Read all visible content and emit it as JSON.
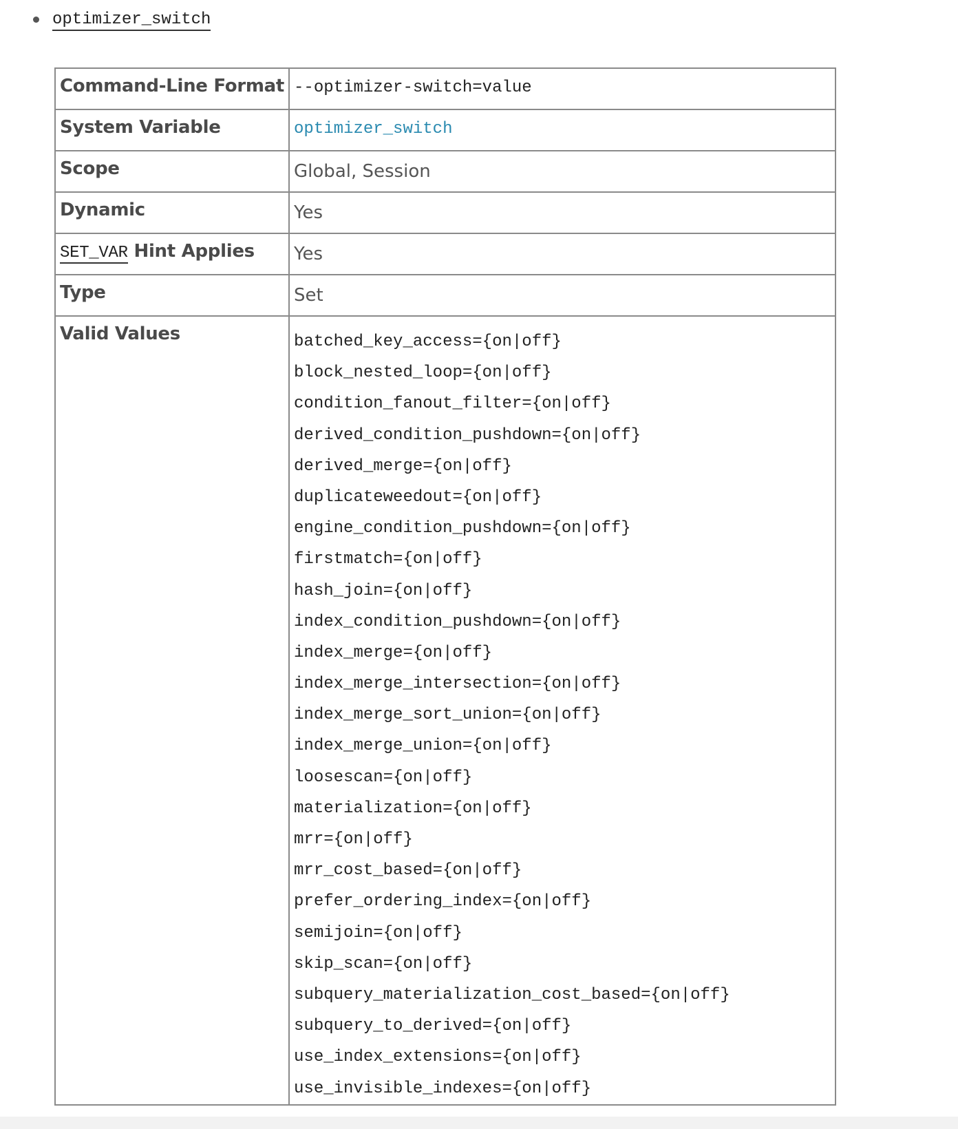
{
  "header": {
    "variable_name": "optimizer_switch"
  },
  "table": {
    "command_line_format_label": "Command-Line Format",
    "command_line_format_value": "--optimizer-switch=value",
    "system_variable_label": "System Variable",
    "system_variable_value": "optimizer_switch",
    "scope_label": "Scope",
    "scope_value": "Global, Session",
    "dynamic_label": "Dynamic",
    "dynamic_value": "Yes",
    "hint_code": "SET_VAR",
    "hint_label": "Hint Applies",
    "hint_value": "Yes",
    "type_label": "Type",
    "type_value": "Set",
    "valid_values_label": "Valid Values",
    "valid_values": [
      "batched_key_access={on|off}",
      "block_nested_loop={on|off}",
      "condition_fanout_filter={on|off}",
      "derived_condition_pushdown={on|off}",
      "derived_merge={on|off}",
      "duplicateweedout={on|off}",
      "engine_condition_pushdown={on|off}",
      "firstmatch={on|off}",
      "hash_join={on|off}",
      "index_condition_pushdown={on|off}",
      "index_merge={on|off}",
      "index_merge_intersection={on|off}",
      "index_merge_sort_union={on|off}",
      "index_merge_union={on|off}",
      "loosescan={on|off}",
      "materialization={on|off}",
      "mrr={on|off}",
      "mrr_cost_based={on|off}",
      "prefer_ordering_index={on|off}",
      "semijoin={on|off}",
      "skip_scan={on|off}",
      "subquery_materialization_cost_based={on|off}",
      "subquery_to_derived={on|off}",
      "use_index_extensions={on|off}",
      "use_invisible_indexes={on|off}"
    ]
  }
}
